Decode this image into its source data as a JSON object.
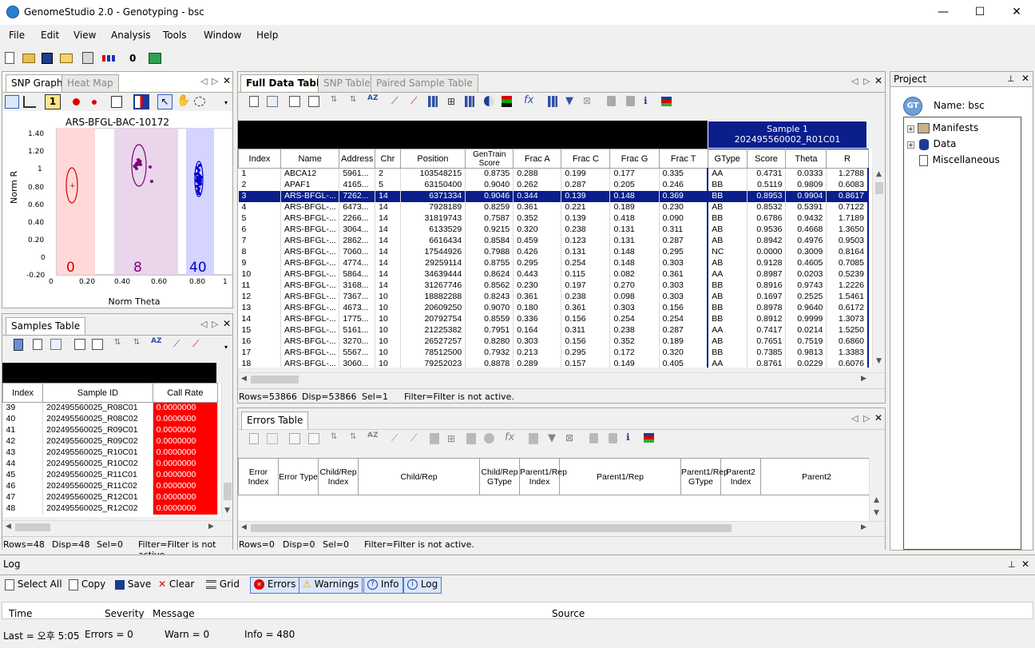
{
  "window": {
    "title": "GenomeStudio 2.0 - Genotyping - bsc",
    "min": "—",
    "max": "☐",
    "close": "✕"
  },
  "menu": [
    "File",
    "Edit",
    "View",
    "Analysis",
    "Tools",
    "Window",
    "Help"
  ],
  "main_toolbar": {
    "zero_label": "0"
  },
  "snp_graph": {
    "tabs": [
      "SNP Graph",
      "Heat Map"
    ],
    "badge": "1",
    "title": "ARS-BFGL-BAC-10172",
    "ylabel": "Norm R",
    "xlabel": "Norm Theta",
    "counts": {
      "aa": "0",
      "ab": "8",
      "bb": "40"
    },
    "yticks": [
      "1.40",
      "1.20",
      "1",
      "0.80",
      "0.60",
      "0.40",
      "0.20",
      "0",
      "-0.20"
    ],
    "xticks": [
      "0",
      "0.20",
      "0.40",
      "0.60",
      "0.80",
      "1"
    ],
    "colors": {
      "aa": "#d40000",
      "ab": "#800080",
      "bb": "#0000cc"
    }
  },
  "samples_table": {
    "tab": "Samples Table",
    "headers": [
      "Index",
      "Sample ID",
      "Call Rate"
    ],
    "rows": [
      [
        "39",
        "202495560025_R08C01",
        "0.0000000"
      ],
      [
        "40",
        "202495560025_R08C02",
        "0.0000000"
      ],
      [
        "41",
        "202495560025_R09C01",
        "0.0000000"
      ],
      [
        "42",
        "202495560025_R09C02",
        "0.0000000"
      ],
      [
        "43",
        "202495560025_R10C01",
        "0.0000000"
      ],
      [
        "44",
        "202495560025_R10C02",
        "0.0000000"
      ],
      [
        "45",
        "202495560025_R11C01",
        "0.0000000"
      ],
      [
        "46",
        "202495560025_R11C02",
        "0.0000000"
      ],
      [
        "47",
        "202495560025_R12C01",
        "0.0000000"
      ],
      [
        "48",
        "202495560025_R12C02",
        "0.0000000"
      ]
    ],
    "status": {
      "rows": "Rows=48",
      "disp": "Disp=48",
      "sel": "Sel=0",
      "filter": "Filter=Filter is not active"
    }
  },
  "full_data": {
    "tabs": [
      "Full Data Table",
      "SNP Table",
      "Paired Sample Table"
    ],
    "sample_header_line1": "Sample 1",
    "sample_header_line2": "202495560002_R01C01",
    "headers": [
      "Index",
      "Name",
      "Address",
      "Chr",
      "Position",
      "GenTrain Score",
      "Frac A",
      "Frac C",
      "Frac G",
      "Frac T",
      "GType",
      "Score",
      "Theta",
      "R"
    ],
    "rows": [
      [
        "1",
        "ABCA12",
        "5961...",
        "2",
        "103548215",
        "0.8735",
        "0.288",
        "0.199",
        "0.177",
        "0.335",
        "AA",
        "0.4731",
        "0.0333",
        "1.2788"
      ],
      [
        "2",
        "APAF1",
        "4165...",
        "5",
        "63150400",
        "0.9040",
        "0.262",
        "0.287",
        "0.205",
        "0.246",
        "BB",
        "0.5119",
        "0.9809",
        "0.6083"
      ],
      [
        "3",
        "ARS-BFGL-...",
        "7262...",
        "14",
        "6371334",
        "0.9046",
        "0.344",
        "0.139",
        "0.148",
        "0.369",
        "BB",
        "0.8953",
        "0.9904",
        "0.8617"
      ],
      [
        "4",
        "ARS-BFGL-...",
        "6473...",
        "14",
        "7928189",
        "0.8259",
        "0.361",
        "0.221",
        "0.189",
        "0.230",
        "AB",
        "0.8532",
        "0.5391",
        "0.7122"
      ],
      [
        "5",
        "ARS-BFGL-...",
        "2266...",
        "14",
        "31819743",
        "0.7587",
        "0.352",
        "0.139",
        "0.418",
        "0.090",
        "BB",
        "0.6786",
        "0.9432",
        "1.7189"
      ],
      [
        "6",
        "ARS-BFGL-...",
        "3064...",
        "14",
        "6133529",
        "0.9215",
        "0.320",
        "0.238",
        "0.131",
        "0.311",
        "AB",
        "0.9536",
        "0.4668",
        "1.3650"
      ],
      [
        "7",
        "ARS-BFGL-...",
        "2862...",
        "14",
        "6616434",
        "0.8584",
        "0.459",
        "0.123",
        "0.131",
        "0.287",
        "AB",
        "0.8942",
        "0.4976",
        "0.9503"
      ],
      [
        "8",
        "ARS-BFGL-...",
        "7060...",
        "14",
        "17544926",
        "0.7988",
        "0.426",
        "0.131",
        "0.148",
        "0.295",
        "NC",
        "0.0000",
        "0.3009",
        "0.8164"
      ],
      [
        "9",
        "ARS-BFGL-...",
        "4774...",
        "14",
        "29259114",
        "0.8755",
        "0.295",
        "0.254",
        "0.148",
        "0.303",
        "AB",
        "0.9128",
        "0.4605",
        "0.7085"
      ],
      [
        "10",
        "ARS-BFGL-...",
        "5864...",
        "14",
        "34639444",
        "0.8624",
        "0.443",
        "0.115",
        "0.082",
        "0.361",
        "AA",
        "0.8987",
        "0.0203",
        "0.5239"
      ],
      [
        "11",
        "ARS-BFGL-...",
        "3168...",
        "14",
        "31267746",
        "0.8562",
        "0.230",
        "0.197",
        "0.270",
        "0.303",
        "BB",
        "0.8916",
        "0.9743",
        "1.2226"
      ],
      [
        "12",
        "ARS-BFGL-...",
        "7367...",
        "10",
        "18882288",
        "0.8243",
        "0.361",
        "0.238",
        "0.098",
        "0.303",
        "AB",
        "0.1697",
        "0.2525",
        "1.5461"
      ],
      [
        "13",
        "ARS-BFGL-...",
        "4673...",
        "10",
        "20609250",
        "0.9070",
        "0.180",
        "0.361",
        "0.303",
        "0.156",
        "BB",
        "0.8978",
        "0.9640",
        "0.6172"
      ],
      [
        "14",
        "ARS-BFGL-...",
        "1775...",
        "10",
        "20792754",
        "0.8559",
        "0.336",
        "0.156",
        "0.254",
        "0.254",
        "BB",
        "0.8912",
        "0.9999",
        "1.3073"
      ],
      [
        "15",
        "ARS-BFGL-...",
        "5161...",
        "10",
        "21225382",
        "0.7951",
        "0.164",
        "0.311",
        "0.238",
        "0.287",
        "AA",
        "0.7417",
        "0.0214",
        "1.5250"
      ],
      [
        "16",
        "ARS-BFGL-...",
        "3270...",
        "10",
        "26527257",
        "0.8280",
        "0.303",
        "0.156",
        "0.352",
        "0.189",
        "AB",
        "0.7651",
        "0.7519",
        "0.6860"
      ],
      [
        "17",
        "ARS-BFGL-...",
        "5567...",
        "10",
        "78512500",
        "0.7932",
        "0.213",
        "0.295",
        "0.172",
        "0.320",
        "BB",
        "0.7385",
        "0.9813",
        "1.3383"
      ],
      [
        "18",
        "ARS-BFGL-...",
        "3060...",
        "10",
        "79252023",
        "0.8878",
        "0.289",
        "0.157",
        "0.149",
        "0.405",
        "AA",
        "0.8761",
        "0.0229",
        "0.6076"
      ]
    ],
    "selected_row": 2,
    "status": {
      "rows": "Rows=53866",
      "disp": "Disp=53866",
      "sel": "Sel=1",
      "filter": "Filter=Filter is not active."
    }
  },
  "errors_table": {
    "tab": "Errors Table",
    "headers": [
      "Error Index",
      "Error Type",
      "Child/Rep Index",
      "Child/Rep",
      "Child/Rep GType",
      "Parent1/Rep Index",
      "Parent1/Rep",
      "Parent1/Rep GType",
      "Parent2 Index",
      "Parent2"
    ],
    "status": {
      "rows": "Rows=0",
      "disp": "Disp=0",
      "sel": "Sel=0",
      "filter": "Filter=Filter is not active."
    }
  },
  "project": {
    "title": "Project",
    "name_label": "Name: bsc",
    "avatar": "GT",
    "tree": [
      "Manifests",
      "Data",
      "Miscellaneous"
    ]
  },
  "log": {
    "title": "Log",
    "buttons": [
      "Select All",
      "Copy",
      "Save",
      "Clear",
      "Grid",
      "Errors",
      "Warnings",
      "Info",
      "Log"
    ],
    "columns": [
      "Time",
      "Severity",
      "Message",
      "Source"
    ],
    "status": {
      "last": "Last = 오후 5:05",
      "errors": "Errors = 0",
      "warn": "Warn = 0",
      "info": "Info = 480"
    }
  }
}
